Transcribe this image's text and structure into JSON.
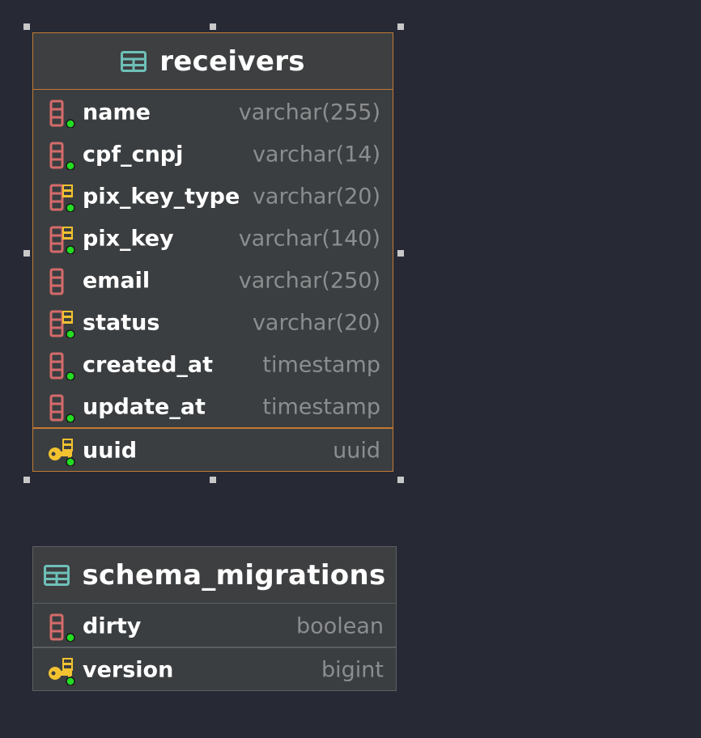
{
  "tables": [
    {
      "name": "receivers",
      "columns": [
        {
          "name": "name",
          "type": "varchar(255)",
          "icon": "column-icon"
        },
        {
          "name": "cpf_cnpj",
          "type": "varchar(14)",
          "icon": "column-icon"
        },
        {
          "name": "pix_key_type",
          "type": "varchar(20)",
          "icon": "indexed-column-icon"
        },
        {
          "name": "pix_key",
          "type": "varchar(140)",
          "icon": "indexed-column-icon"
        },
        {
          "name": "email",
          "type": "varchar(250)",
          "icon": "column-nullable-icon"
        },
        {
          "name": "status",
          "type": "varchar(20)",
          "icon": "indexed-column-icon"
        },
        {
          "name": "created_at",
          "type": "timestamp",
          "icon": "column-icon"
        },
        {
          "name": "update_at",
          "type": "timestamp",
          "icon": "column-icon"
        }
      ],
      "keys": [
        {
          "name": "uuid",
          "type": "uuid",
          "icon": "primary-key-icon"
        }
      ],
      "border_color": "#c27a32"
    },
    {
      "name": "schema_migrations",
      "columns": [
        {
          "name": "dirty",
          "type": "boolean",
          "icon": "column-icon"
        }
      ],
      "keys": [
        {
          "name": "version",
          "type": "bigint",
          "icon": "primary-key-icon"
        }
      ],
      "border_color": "#5c5f61"
    }
  ],
  "colors": {
    "background": "#272a35",
    "table_icon": "#6ec0b8",
    "column_icon": "#d46b6b",
    "key_icon": "#f2c230",
    "not_null_dot": "#22dd22",
    "selected_border": "#c27a32"
  }
}
